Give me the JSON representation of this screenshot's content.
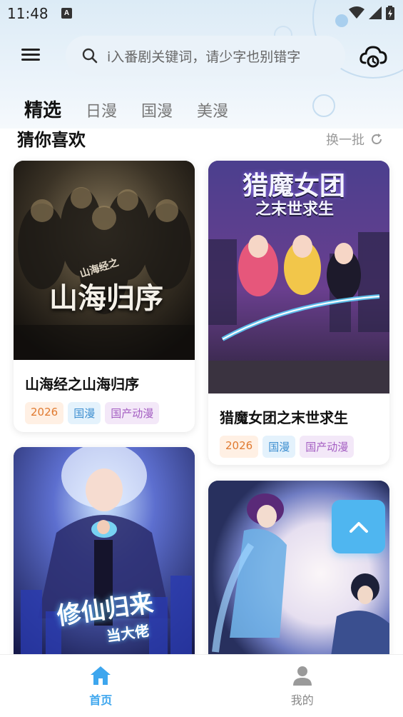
{
  "status_bar": {
    "time": "11:48",
    "notification_icon": "A"
  },
  "header": {
    "search_placeholder": "i入番剧关键词，请少字也别错字"
  },
  "tabs": [
    {
      "label": "精选",
      "active": true
    },
    {
      "label": "日漫",
      "active": false
    },
    {
      "label": "国漫",
      "active": false
    },
    {
      "label": "美漫",
      "active": false
    }
  ],
  "section": {
    "title": "猜你喜欢",
    "refresh_label": "换一批"
  },
  "cards": [
    {
      "title": "山海经之山海归序",
      "poster_art_text": "山海归序",
      "poster_art_small": "山海经之",
      "tags": [
        "2026",
        "国漫",
        "国产动漫"
      ]
    },
    {
      "title": "猎魔女团之末世求生",
      "poster_art_text": "猎魔女团",
      "poster_art_small": "之末世求生",
      "tags": [
        "2026",
        "国漫",
        "国产动漫"
      ]
    },
    {
      "title": "",
      "poster_art_text": "修仙归来",
      "poster_art_small": "当大佬",
      "tags": []
    },
    {
      "title": "",
      "poster_art_text": "",
      "poster_art_small": "",
      "tags": []
    }
  ],
  "bottom_nav": [
    {
      "label": "首页",
      "icon": "home-icon",
      "active": true
    },
    {
      "label": "我的",
      "icon": "user-icon",
      "active": false
    }
  ],
  "colors": {
    "accent": "#3da6ee",
    "fab": "#4fb6f0",
    "tag_year": "#e07a30",
    "tag_category": "#3d8ed0",
    "tag_genre": "#a45ec2"
  }
}
